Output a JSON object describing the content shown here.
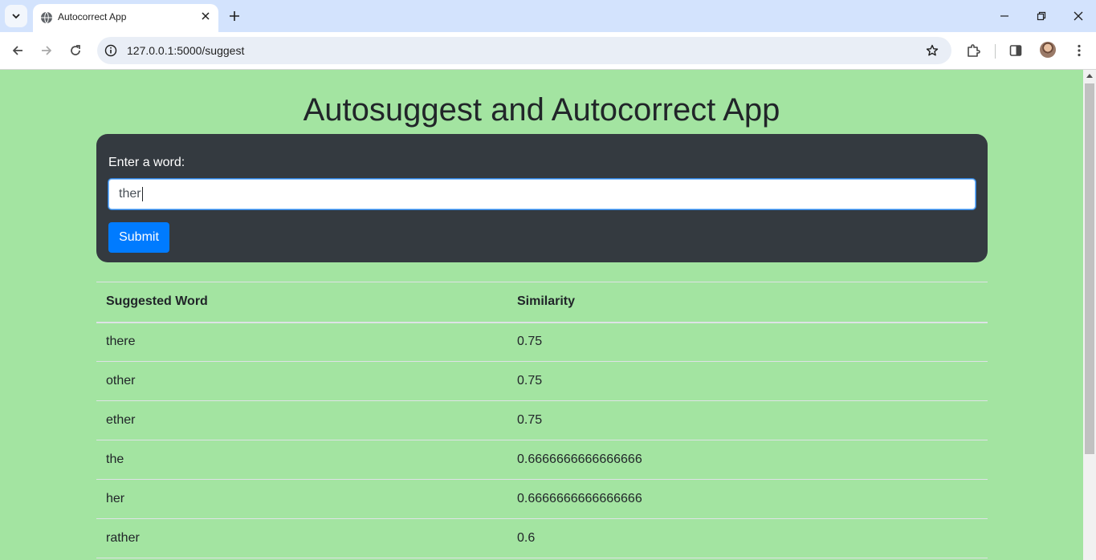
{
  "browser": {
    "tab_title": "Autocorrect App",
    "url": "127.0.0.1:5000/suggest"
  },
  "page": {
    "title": "Autosuggest and Autocorrect App",
    "background_color": "#a3e4a1",
    "form": {
      "label": "Enter a word:",
      "input_value": "ther",
      "submit_label": "Submit"
    },
    "table": {
      "headers": [
        "Suggested Word",
        "Similarity"
      ],
      "rows": [
        {
          "word": "there",
          "similarity": "0.75"
        },
        {
          "word": "other",
          "similarity": "0.75"
        },
        {
          "word": "ether",
          "similarity": "0.75"
        },
        {
          "word": "the",
          "similarity": "0.6666666666666666"
        },
        {
          "word": "her",
          "similarity": "0.6666666666666666"
        },
        {
          "word": "rather",
          "similarity": "0.6"
        }
      ]
    }
  },
  "icons": {
    "tab_search": "chevron-down-icon",
    "favicon": "globe-icon",
    "tab_close": "close-icon",
    "new_tab": "plus-icon",
    "back": "back-arrow-icon",
    "forward": "forward-arrow-icon",
    "reload": "reload-icon",
    "site_info": "info-icon",
    "bookmark": "star-icon",
    "extensions": "puzzle-icon",
    "side_panel": "side-panel-icon",
    "menu": "kebab-menu-icon"
  }
}
